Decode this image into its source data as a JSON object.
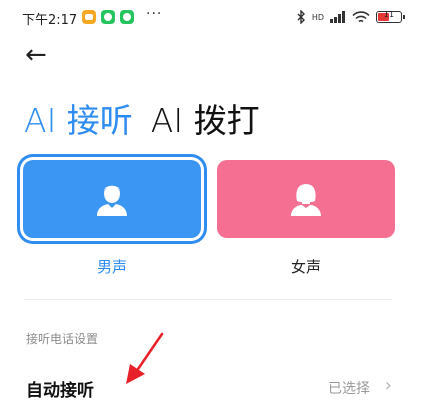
{
  "status_bar": {
    "time": "下午2:17",
    "more": "···",
    "network_label": "HD",
    "battery_level": "11",
    "battery_color": "#e53935"
  },
  "nav": {
    "back_icon": "←"
  },
  "tabs": [
    {
      "label": "AI 接听",
      "active": true
    },
    {
      "label": "AI 拨打",
      "active": false
    }
  ],
  "voices": [
    {
      "label": "男声",
      "selected": true,
      "color": "#3b95f2"
    },
    {
      "label": "女声",
      "selected": false,
      "color": "#f56f92"
    }
  ],
  "settings": {
    "section_title": "接听电话设置",
    "auto_answer": {
      "title": "自动接听",
      "value": "已选择",
      "chevron": "›"
    }
  },
  "colors": {
    "accent": "#2f8cf0",
    "annotation_arrow": "#e8202a"
  }
}
